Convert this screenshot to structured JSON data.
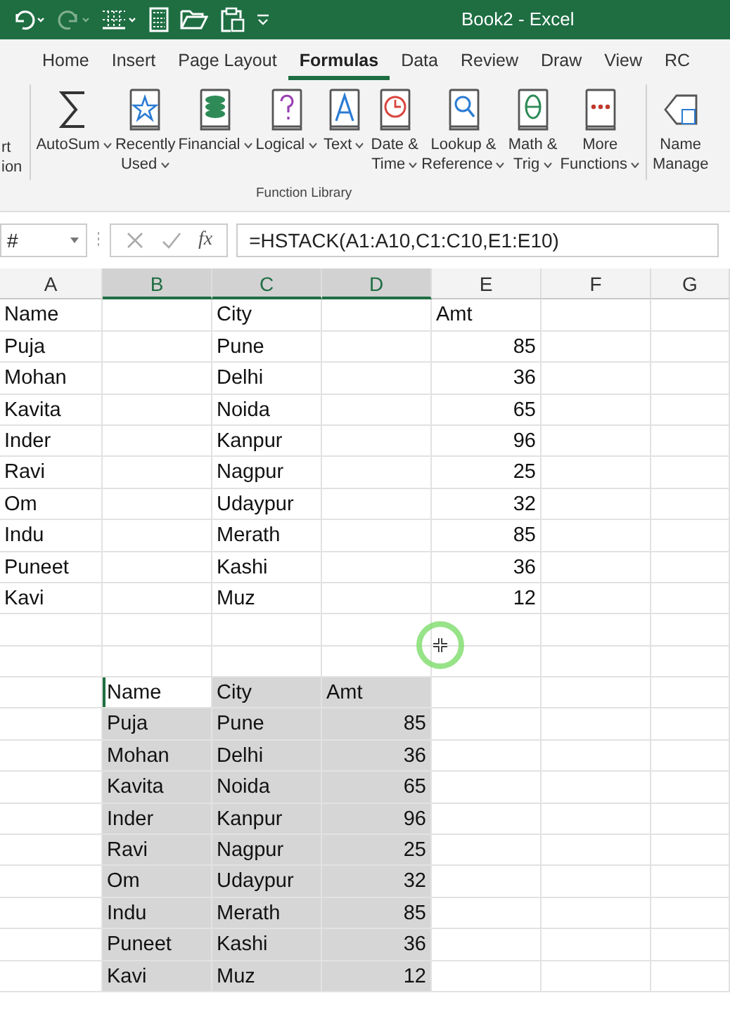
{
  "window": {
    "title": "Book2  -  Excel"
  },
  "tabs": [
    {
      "label": "Home",
      "selected": false
    },
    {
      "label": "Insert",
      "selected": false
    },
    {
      "label": "Page Layout",
      "selected": false
    },
    {
      "label": "Formulas",
      "selected": true
    },
    {
      "label": "Data",
      "selected": false
    },
    {
      "label": "Review",
      "selected": false
    },
    {
      "label": "Draw",
      "selected": false
    },
    {
      "label": "View",
      "selected": false
    },
    {
      "label": "RC",
      "selected": false
    }
  ],
  "ribbon": {
    "buttons": [
      {
        "lines": [
          "rt",
          "ion"
        ],
        "dropdown": false
      },
      {
        "lines": [
          "AutoSum"
        ],
        "dropdown": true
      },
      {
        "lines": [
          "Recently",
          "Used"
        ],
        "dropdown": true
      },
      {
        "lines": [
          "Financial"
        ],
        "dropdown": true
      },
      {
        "lines": [
          "Logical"
        ],
        "dropdown": true
      },
      {
        "lines": [
          "Text"
        ],
        "dropdown": true
      },
      {
        "lines": [
          "Date &",
          "Time"
        ],
        "dropdown": true
      },
      {
        "lines": [
          "Lookup &",
          "Reference"
        ],
        "dropdown": true
      },
      {
        "lines": [
          "Math &",
          "Trig"
        ],
        "dropdown": true
      },
      {
        "lines": [
          "More",
          "Functions"
        ],
        "dropdown": true
      },
      {
        "lines": [
          "Name",
          "Manage"
        ],
        "dropdown": false
      }
    ],
    "group_label": "Function Library"
  },
  "formula_bar": {
    "name_box": "#",
    "fx": "fx",
    "formula": "=HSTACK(A1:A10,C1:C10,E1:E10)"
  },
  "columns": [
    {
      "label": "A",
      "selected": false
    },
    {
      "label": "B",
      "selected": true
    },
    {
      "label": "C",
      "selected": true
    },
    {
      "label": "D",
      "selected": true
    },
    {
      "label": "E",
      "selected": false
    },
    {
      "label": "F",
      "selected": false
    },
    {
      "label": "G",
      "selected": false
    }
  ],
  "rows": [
    {
      "selected": false,
      "cells": {
        "A": {
          "text": "Name"
        },
        "C": {
          "text": "City"
        },
        "E": {
          "text": "Amt"
        }
      }
    },
    {
      "selected": false,
      "cells": {
        "A": {
          "text": "Puja"
        },
        "C": {
          "text": "Pune"
        },
        "E": {
          "text": "85",
          "kind": "number"
        }
      }
    },
    {
      "selected": false,
      "cells": {
        "A": {
          "text": "Mohan"
        },
        "C": {
          "text": "Delhi"
        },
        "E": {
          "text": "36",
          "kind": "number"
        }
      }
    },
    {
      "selected": false,
      "cells": {
        "A": {
          "text": "Kavita"
        },
        "C": {
          "text": "Noida"
        },
        "E": {
          "text": "65",
          "kind": "number"
        }
      }
    },
    {
      "selected": false,
      "cells": {
        "A": {
          "text": "Inder"
        },
        "C": {
          "text": "Kanpur"
        },
        "E": {
          "text": "96",
          "kind": "number"
        }
      }
    },
    {
      "selected": false,
      "cells": {
        "A": {
          "text": "Ravi"
        },
        "C": {
          "text": "Nagpur"
        },
        "E": {
          "text": "25",
          "kind": "number"
        }
      }
    },
    {
      "selected": false,
      "cells": {
        "A": {
          "text": "Om"
        },
        "C": {
          "text": "Udaypur"
        },
        "E": {
          "text": "32",
          "kind": "number"
        }
      }
    },
    {
      "selected": false,
      "cells": {
        "A": {
          "text": "Indu"
        },
        "C": {
          "text": "Merath"
        },
        "E": {
          "text": "85",
          "kind": "number"
        }
      }
    },
    {
      "selected": false,
      "cells": {
        "A": {
          "text": "Puneet"
        },
        "C": {
          "text": "Kashi"
        },
        "E": {
          "text": "36",
          "kind": "number"
        }
      }
    },
    {
      "selected": false,
      "cells": {
        "A": {
          "text": "Kavi"
        },
        "C": {
          "text": "Muz"
        },
        "E": {
          "text": "12",
          "kind": "number"
        }
      }
    },
    {
      "selected": false,
      "cells": {}
    },
    {
      "selected": false,
      "cells": {}
    },
    {
      "selected": true,
      "cells": {
        "B": {
          "text": "Name"
        },
        "C": {
          "text": "City"
        },
        "D": {
          "text": "Amt"
        }
      }
    },
    {
      "selected": true,
      "cells": {
        "B": {
          "text": "Puja"
        },
        "C": {
          "text": "Pune"
        },
        "D": {
          "text": "85",
          "kind": "number"
        }
      }
    },
    {
      "selected": true,
      "cells": {
        "B": {
          "text": "Mohan"
        },
        "C": {
          "text": "Delhi"
        },
        "D": {
          "text": "36",
          "kind": "number"
        }
      }
    },
    {
      "selected": true,
      "cells": {
        "B": {
          "text": "Kavita"
        },
        "C": {
          "text": "Noida"
        },
        "D": {
          "text": "65",
          "kind": "number"
        }
      }
    },
    {
      "selected": true,
      "cells": {
        "B": {
          "text": "Inder"
        },
        "C": {
          "text": "Kanpur"
        },
        "D": {
          "text": "96",
          "kind": "number"
        }
      }
    },
    {
      "selected": true,
      "cells": {
        "B": {
          "text": "Ravi"
        },
        "C": {
          "text": "Nagpur"
        },
        "D": {
          "text": "25",
          "kind": "number"
        }
      }
    },
    {
      "selected": true,
      "cells": {
        "B": {
          "text": "Om"
        },
        "C": {
          "text": "Udaypur"
        },
        "D": {
          "text": "32",
          "kind": "number"
        }
      }
    },
    {
      "selected": true,
      "cells": {
        "B": {
          "text": "Indu"
        },
        "C": {
          "text": "Merath"
        },
        "D": {
          "text": "85",
          "kind": "number"
        }
      }
    },
    {
      "selected": true,
      "cells": {
        "B": {
          "text": "Puneet"
        },
        "C": {
          "text": "Kashi"
        },
        "D": {
          "text": "36",
          "kind": "number"
        }
      }
    },
    {
      "selected": true,
      "cells": {
        "B": {
          "text": "Kavi"
        },
        "C": {
          "text": "Muz"
        },
        "D": {
          "text": "12",
          "kind": "number"
        }
      }
    }
  ]
}
